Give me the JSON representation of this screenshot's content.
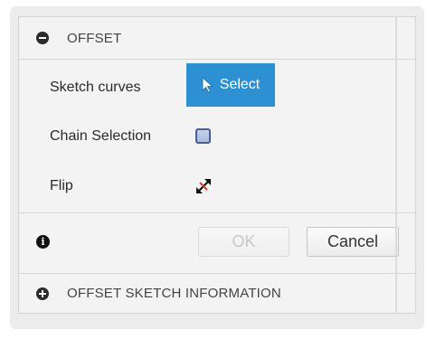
{
  "offset_section": {
    "title": "OFFSET",
    "toggle_icon": "collapse-minus-icon"
  },
  "rows": {
    "sketch_curves_label": "Sketch curves",
    "select_button_label": "Select",
    "select_icon": "cursor-arrow-icon",
    "chain_selection_label": "Chain Selection",
    "chain_selection_checked": false,
    "flip_label": "Flip",
    "flip_icon": "flip-arrows-icon"
  },
  "footer": {
    "info_icon": "info-icon",
    "ok_label": "OK",
    "ok_enabled": false,
    "cancel_label": "Cancel"
  },
  "info_section": {
    "title": "OFFSET SKETCH INFORMATION",
    "toggle_icon": "expand-plus-icon"
  },
  "colors": {
    "accent": "#2d90d2",
    "dialog_bg": "#f3f3f3",
    "checkbox_fill": "#b7c7e5"
  }
}
